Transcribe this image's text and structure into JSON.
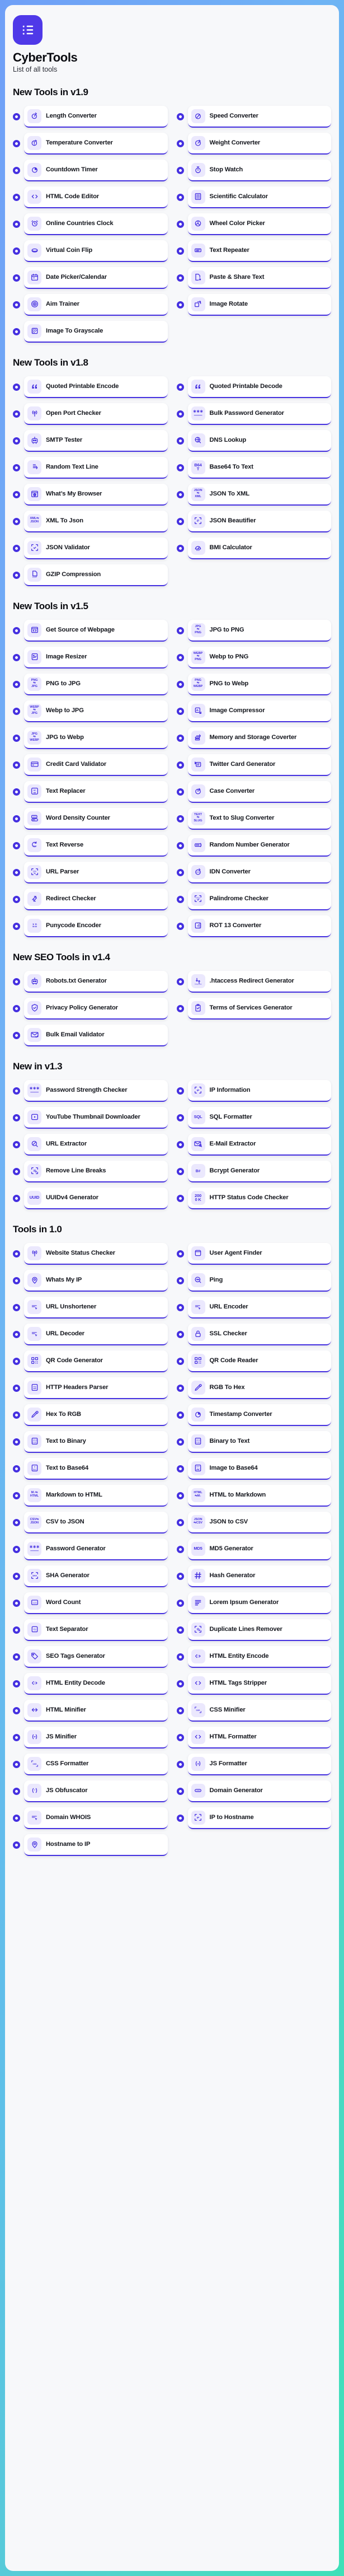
{
  "header": {
    "logo_icon": "starred-list-icon",
    "title": "CyberTools",
    "subtitle": "List of all tools"
  },
  "colors": {
    "accent": "#4530e0",
    "logo_bg": "#4f39e8",
    "icon_tile_bg": "#ebe8fd",
    "panel_bg": "#f7f8fa",
    "card_bg": "#ffffff",
    "page_gradient_from": "#6f9ff7",
    "page_gradient_to": "#3ee0b8",
    "text": "#14161d"
  },
  "sections": [
    {
      "title": "New Tools in v1.9",
      "tools": [
        {
          "label": "Length Converter",
          "icon": "ruler-compass-icon"
        },
        {
          "label": "Speed Converter",
          "icon": "speedometer-icon"
        },
        {
          "label": "Temperature Converter",
          "icon": "thermometer-icon"
        },
        {
          "label": "Weight Converter",
          "icon": "scale-icon"
        },
        {
          "label": "Countdown Timer",
          "icon": "timer-pie-icon"
        },
        {
          "label": "Stop Watch",
          "icon": "stopwatch-icon"
        },
        {
          "label": "HTML Code Editor",
          "icon": "code-brackets-icon"
        },
        {
          "label": "Scientific Calculator",
          "icon": "calculator-icon"
        },
        {
          "label": "Online Countries Clock",
          "icon": "alarm-clock-icon"
        },
        {
          "label": "Wheel Color Picker",
          "icon": "color-wheel-icon"
        },
        {
          "label": "Virtual Coin Flip",
          "icon": "coin-icon"
        },
        {
          "label": "Text Repeater",
          "icon": "text-box-icon"
        },
        {
          "label": "Date Picker/Calendar",
          "icon": "calendar-icon"
        },
        {
          "label": "Paste & Share Text",
          "icon": "share-document-icon"
        },
        {
          "label": "Aim Trainer",
          "icon": "target-icon"
        },
        {
          "label": "Image Rotate",
          "icon": "rotate-image-icon"
        },
        {
          "label": "Image To Grayscale",
          "icon": "grayscale-icon"
        }
      ]
    },
    {
      "title": "New Tools in v1.8",
      "tools": [
        {
          "label": "Quoted Printable Encode",
          "icon": "quote-icon"
        },
        {
          "label": "Quoted Printable Decode",
          "icon": "quote-icon"
        },
        {
          "label": "Open Port Checker",
          "icon": "broadcast-icon"
        },
        {
          "label": "Bulk Password Generator",
          "icon": "password-dots-icon"
        },
        {
          "label": "SMTP Tester",
          "icon": "robot-icon"
        },
        {
          "label": "DNS Lookup",
          "icon": "dns-globe-icon"
        },
        {
          "label": "Random Text Line",
          "icon": "shuffle-text-icon"
        },
        {
          "label": "Base64 To Text",
          "icon": "b64-to-text-icon"
        },
        {
          "label": "What’s My Browser",
          "icon": "browser-globe-icon"
        },
        {
          "label": "JSON To XML",
          "icon": "json-to-xml-icon"
        },
        {
          "label": "XML To Json",
          "icon": "xml-to-json-icon"
        },
        {
          "label": "JSON Beautifier",
          "icon": "json-brace-icon"
        },
        {
          "label": "JSON Validator",
          "icon": "json-check-icon"
        },
        {
          "label": "BMI Calculator",
          "icon": "bmi-icon"
        },
        {
          "label": "GZIP Compression",
          "icon": "gzip-file-icon"
        }
      ]
    },
    {
      "title": "New Tools in v1.5",
      "tools": [
        {
          "label": "Get Source of Webpage",
          "icon": "browser-code-icon"
        },
        {
          "label": "JPG to PNG",
          "icon": "jpg-png-icon"
        },
        {
          "label": "Image Resizer",
          "icon": "image-resize-icon"
        },
        {
          "label": "Webp to PNG",
          "icon": "webp-png-icon"
        },
        {
          "label": "PNG to JPG",
          "icon": "png-jpg-icon"
        },
        {
          "label": "PNG to Webp",
          "icon": "png-webp-icon"
        },
        {
          "label": "Webp to JPG",
          "icon": "webp-jpg-icon"
        },
        {
          "label": "Image Compressor",
          "icon": "image-compress-icon"
        },
        {
          "label": "JPG to Webp",
          "icon": "jpg-webp-icon"
        },
        {
          "label": "Memory and Storage Coverter",
          "icon": "storage-convert-icon"
        },
        {
          "label": "Credit Card Validator",
          "icon": "credit-card-icon"
        },
        {
          "label": "Twitter Card Generator",
          "icon": "twitter-card-icon"
        },
        {
          "label": "Text Replacer",
          "icon": "ab-replace-icon"
        },
        {
          "label": "Case Converter",
          "icon": "case-convert-icon"
        },
        {
          "label": "Word Density Counter",
          "icon": "word-density-icon"
        },
        {
          "label": "Text to Slug Converter",
          "icon": "text-slug-icon"
        },
        {
          "label": "Text Reverse",
          "icon": "reverse-text-icon"
        },
        {
          "label": "Random Number Generator",
          "icon": "random-number-icon"
        },
        {
          "label": "URL Parser",
          "icon": "http-scan-icon"
        },
        {
          "label": "IDN Converter",
          "icon": "idn-refresh-icon"
        },
        {
          "label": "Redirect Checker",
          "icon": "redirect-arrows-icon"
        },
        {
          "label": "Palindrome Checker",
          "icon": "text-check-icon"
        },
        {
          "label": "Punycode Encoder",
          "icon": "punycode-icon"
        },
        {
          "label": "ROT 13 Converter",
          "icon": "rot13-icon"
        }
      ]
    },
    {
      "title": "New SEO Tools in v1.4",
      "tools": [
        {
          "label": "Robots.txt Generator",
          "icon": "robot-icon"
        },
        {
          "label": ".htaccess Redirect Generator",
          "icon": "htaccess-icon"
        },
        {
          "label": "Privacy Policy Generator",
          "icon": "shield-check-icon"
        },
        {
          "label": "Terms of Services Generator",
          "icon": "clipboard-check-icon"
        },
        {
          "label": "Bulk Email Validator",
          "icon": "email-check-icon"
        }
      ]
    },
    {
      "title": "New in v1.3",
      "tools": [
        {
          "label": "Password Strength Checker",
          "icon": "password-dots-icon"
        },
        {
          "label": "IP Information",
          "icon": "ip-scan-icon"
        },
        {
          "label": "YouTube Thumbnail Downloader",
          "icon": "play-box-icon"
        },
        {
          "label": "SQL Formatter",
          "icon": "sql-icon"
        },
        {
          "label": "URL Extractor",
          "icon": "url-search-icon"
        },
        {
          "label": "E-Mail Extractor",
          "icon": "email-search-icon"
        },
        {
          "label": "Remove Line Breaks",
          "icon": "remove-breaks-icon"
        },
        {
          "label": "Bcrypt Generator",
          "icon": "bcrypt-icon"
        },
        {
          "label": "UUIDv4 Generator",
          "icon": "uuid-icon"
        },
        {
          "label": "HTTP Status Code Checker",
          "icon": "http-200-icon"
        }
      ]
    },
    {
      "title": "Tools in 1.0",
      "tools": [
        {
          "label": "Website Status Checker",
          "icon": "broadcast-icon"
        },
        {
          "label": "User Agent Finder",
          "icon": "window-icon"
        },
        {
          "label": "Whats My IP",
          "icon": "map-pin-icon"
        },
        {
          "label": "Ping",
          "icon": "ping-search-icon"
        },
        {
          "label": "URL Unshortener",
          "icon": "link-cursor-icon"
        },
        {
          "label": "URL Encoder",
          "icon": "link-cursor-icon"
        },
        {
          "label": "URL Decoder",
          "icon": "link-cursor-icon"
        },
        {
          "label": "SSL Checker",
          "icon": "lock-icon"
        },
        {
          "label": "QR Code Generator",
          "icon": "qr-code-icon"
        },
        {
          "label": "QR Code Reader",
          "icon": "qr-code-icon"
        },
        {
          "label": "HTTP Headers Parser",
          "icon": "http-doc-icon"
        },
        {
          "label": "RGB To Hex",
          "icon": "eyedropper-icon"
        },
        {
          "label": "Hex To RGB",
          "icon": "eyedropper-icon"
        },
        {
          "label": "Timestamp Converter",
          "icon": "timer-pie-icon"
        },
        {
          "label": "Text to Binary",
          "icon": "binary-icon"
        },
        {
          "label": "Binary to Text",
          "icon": "binary-icon"
        },
        {
          "label": "Text to Base64",
          "icon": "text-b64-icon"
        },
        {
          "label": "Image to Base64",
          "icon": "image-b64-icon"
        },
        {
          "label": "Markdown to HTML",
          "icon": "md-html-icon"
        },
        {
          "label": "HTML to Markdown",
          "icon": "html-md-icon"
        },
        {
          "label": "CSV to JSON",
          "icon": "csv-json-icon"
        },
        {
          "label": "JSON to CSV",
          "icon": "json-csv-icon"
        },
        {
          "label": "Password Generator",
          "icon": "password-dots-icon"
        },
        {
          "label": "MD5 Generator",
          "icon": "md5-icon"
        },
        {
          "label": "SHA Generator",
          "icon": "sha-icon"
        },
        {
          "label": "Hash Generator",
          "icon": "hash-icon"
        },
        {
          "label": "Word Count",
          "icon": "number-box-icon"
        },
        {
          "label": "Lorem Ipsum Generator",
          "icon": "lines-icon"
        },
        {
          "label": "Text Separator",
          "icon": "text-separator-icon"
        },
        {
          "label": "Duplicate Lines Remover",
          "icon": "remove-breaks-icon"
        },
        {
          "label": "SEO Tags Generator",
          "icon": "tag-icon"
        },
        {
          "label": "HTML Entity Encode",
          "icon": "entity-code-icon"
        },
        {
          "label": "HTML Entity Decode",
          "icon": "entity-code-icon"
        },
        {
          "label": "HTML Tags Stripper",
          "icon": "code-brackets-icon"
        },
        {
          "label": "HTML Minifier",
          "icon": "minify-arrows-icon"
        },
        {
          "label": "CSS Minifier",
          "icon": "css-icon"
        },
        {
          "label": "JS Minifier",
          "icon": "js-minus-icon"
        },
        {
          "label": "HTML Formatter",
          "icon": "code-brackets-icon"
        },
        {
          "label": "CSS Formatter",
          "icon": "css-icon"
        },
        {
          "label": "JS Formatter",
          "icon": "js-brace-icon"
        },
        {
          "label": "JS Obfuscator",
          "icon": "js-star-icon"
        },
        {
          "label": "Domain Generator",
          "icon": "domain-icon"
        },
        {
          "label": "Domain WHOIS",
          "icon": "link-cursor-icon"
        },
        {
          "label": "IP to Hostname",
          "icon": "ip-scan-icon"
        },
        {
          "label": "Hostname to IP",
          "icon": "map-pin-icon"
        }
      ]
    }
  ]
}
